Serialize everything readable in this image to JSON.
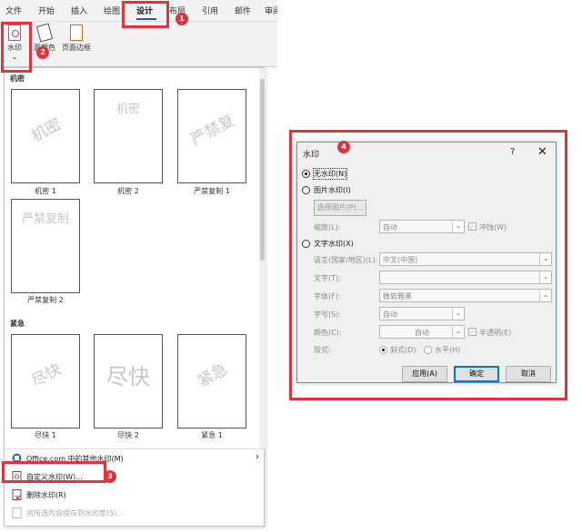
{
  "ribbon": {
    "tabs": [
      "文件",
      "开始",
      "插入",
      "绘图",
      "设计",
      "布局",
      "引用",
      "邮件",
      "审阅"
    ],
    "active_tab": "设计",
    "buttons": {
      "watermark": "水印",
      "watermark_arrow": "⌄",
      "page_color": "页面颜色",
      "page_color_visible": "面颜色",
      "page_border": "页面边框"
    }
  },
  "gallery": {
    "sections": [
      {
        "title": "机密",
        "items": [
          {
            "label": "机密 1",
            "mark": "机密"
          },
          {
            "label": "机密 2",
            "mark": "机密"
          },
          {
            "label": "严禁复制 1",
            "mark": "严禁复"
          },
          {
            "label": "严禁复制 2",
            "mark": "严禁复制"
          }
        ]
      },
      {
        "title": "紧急",
        "items": [
          {
            "label": "尽快 1",
            "mark": "尽快"
          },
          {
            "label": "尽快 2",
            "mark": "尽快"
          },
          {
            "label": "紧急 1",
            "mark": "紧急"
          }
        ]
      }
    ],
    "menu": [
      {
        "label": "Office.com 中的其他水印(M)",
        "icon": "office-icon",
        "submenu_arrow": "›"
      },
      {
        "label": "自定义水印(W)...",
        "icon": "custom-watermark-icon"
      },
      {
        "label": "删除水印(R)",
        "icon": "remove-watermark-icon"
      },
      {
        "label": "将所选内容保存到水印库(S)...",
        "icon": "save-gallery-icon",
        "disabled": true
      }
    ]
  },
  "annotations": [
    "1",
    "2",
    "3",
    "4"
  ],
  "dialog": {
    "title": "水印",
    "help": "?",
    "close": "✕",
    "no_watermark": "无水印(N)",
    "picture_watermark": "图片水印(I)",
    "select_picture": "选择图片(P)...",
    "scale_label": "缩放(L):",
    "scale_value": "自动",
    "washout_label": "冲蚀(W)",
    "text_watermark": "文字水印(X)",
    "language_label": "语言(国家/地区)(L):",
    "language_value": "中文(中国)",
    "text_label": "文字(T):",
    "text_value": "",
    "font_label": "字体(F):",
    "font_value": "微软雅黑",
    "size_label": "字号(S):",
    "size_value": "自动",
    "color_label": "颜色(C):",
    "color_value": "自动",
    "semitransparent_label": "半透明(E)",
    "layout_label": "版式:",
    "diagonal_label": "斜式(D)",
    "horizontal_label": "水平(H)",
    "apply_button": "应用(A)",
    "ok_button": "确定",
    "cancel_button": "取消"
  },
  "colors": {
    "annotation": "#e3323b",
    "accent": "#0078d7"
  }
}
